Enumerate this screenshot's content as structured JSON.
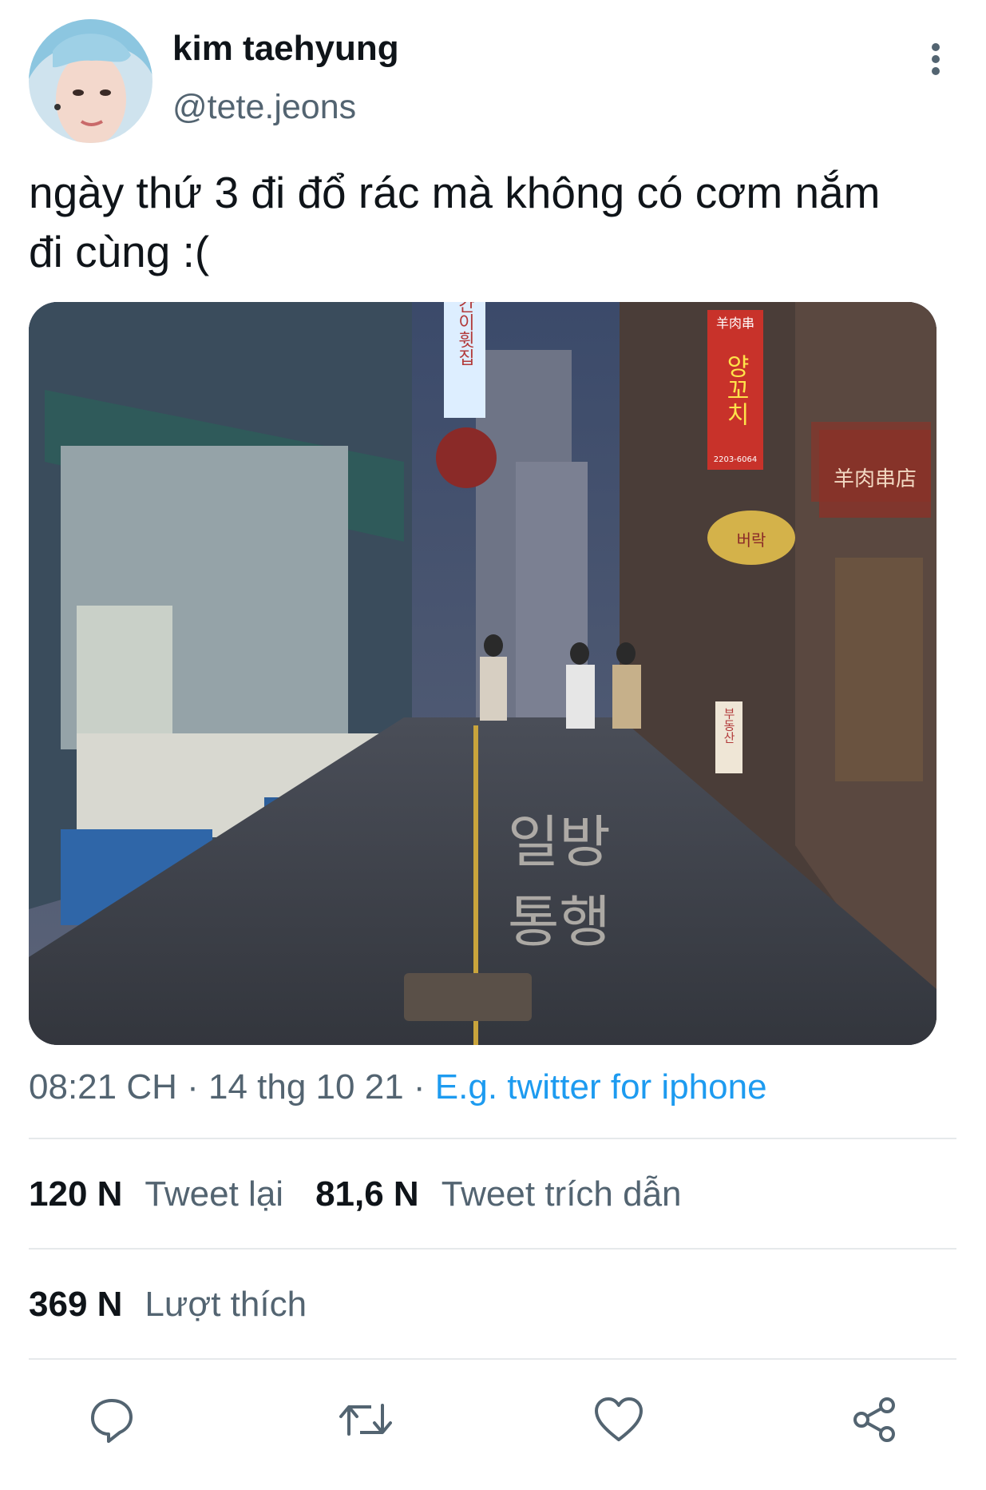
{
  "tweet": {
    "author": {
      "display_name": "kim taehyung",
      "handle": "@tete.jeons"
    },
    "text_lines": [
      "ngày thứ 3 đi đổ rác mà không có cơm nắm",
      "đi cùng :("
    ],
    "meta": {
      "time": "08:21 CH",
      "separator": " · ",
      "date": "14 thg 10 21",
      "source": "E.g. twitter for iphone"
    },
    "stats": {
      "retweets_count": "120 N",
      "retweets_label": "Tweet lại",
      "quotes_count": "81,6 N",
      "quotes_label": "Tweet trích dẫn",
      "likes_count": "369 N",
      "likes_label": "Lượt thích"
    },
    "media_signs": {
      "sign_left": "간이휫집",
      "sign_right": "양꼬치",
      "sign_right_top": "羊肉串",
      "sign_right_phone": "2203-6064",
      "sign_far_right": "羊肉串店",
      "sign_bakery": "버락",
      "sign_realty": "부동산",
      "road_marking_1": "일방",
      "road_marking_2": "통행"
    }
  },
  "actions": [
    {
      "name": "reply-icon"
    },
    {
      "name": "retweet-icon"
    },
    {
      "name": "like-icon"
    },
    {
      "name": "share-icon"
    }
  ],
  "colors": {
    "primary_text": "#0f1419",
    "secondary_text": "#536471",
    "link": "#1d9bf0",
    "divider": "#e6e9eb"
  }
}
